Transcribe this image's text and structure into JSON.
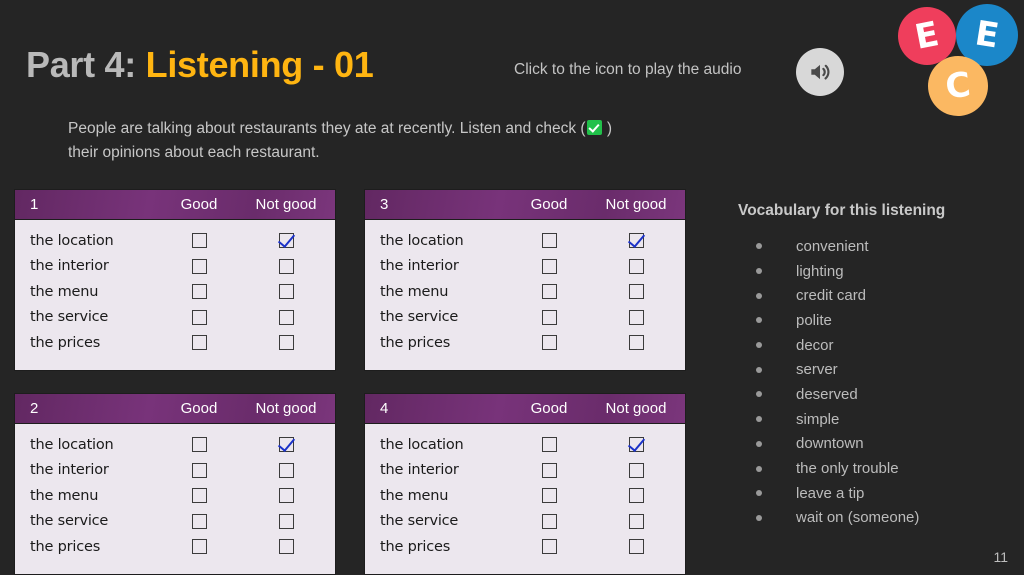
{
  "slide": {
    "background_color": "#252525",
    "page_number": "11"
  },
  "header": {
    "title_part": "Part 4:",
    "title_highlight": "Listening - 01",
    "title_part_color": "#b9b9b9",
    "title_highlight_color": "#ffb511",
    "audio_hint": "Click to the icon to play the audio",
    "audio_icon": "speaker-volume-icon"
  },
  "logo": {
    "circles": [
      {
        "letter": "E",
        "color": "#ef3e5c"
      },
      {
        "letter": "E",
        "color": "#1b87c9"
      },
      {
        "letter": "C",
        "color": "#fbb košice"
      }
    ]
  },
  "logo_fixed": {
    "e1_letter": "E",
    "e1_color": "#ef3e5c",
    "e2_letter": "E",
    "e2_color": "#1b87c9",
    "c_letter": "C",
    "c_color": "#fbb862"
  },
  "instruction": {
    "line1_before": "People are talking about restaurants they ate at recently. Listen and check (",
    "check_icon": "green-check-emoji",
    "line1_after": " )",
    "line2": "their opinions about each restaurant."
  },
  "tables": {
    "columns": {
      "good": "Good",
      "not_good": "Not good"
    },
    "row_labels": [
      "the location",
      "the interior",
      "the menu",
      "the service",
      "the prices"
    ],
    "items": [
      {
        "number": "1",
        "rows": [
          {
            "label": "the location",
            "good": false,
            "not_good": true
          },
          {
            "label": "the interior",
            "good": false,
            "not_good": false
          },
          {
            "label": "the menu",
            "good": false,
            "not_good": false
          },
          {
            "label": "the service",
            "good": false,
            "not_good": false
          },
          {
            "label": "the prices",
            "good": false,
            "not_good": false
          }
        ]
      },
      {
        "number": "2",
        "rows": [
          {
            "label": "the location",
            "good": false,
            "not_good": true
          },
          {
            "label": "the interior",
            "good": false,
            "not_good": false
          },
          {
            "label": "the menu",
            "good": false,
            "not_good": false
          },
          {
            "label": "the service",
            "good": false,
            "not_good": false
          },
          {
            "label": "the prices",
            "good": false,
            "not_good": false
          }
        ]
      },
      {
        "number": "3",
        "rows": [
          {
            "label": "the location",
            "good": false,
            "not_good": true
          },
          {
            "label": "the interior",
            "good": false,
            "not_good": false
          },
          {
            "label": "the menu",
            "good": false,
            "not_good": false
          },
          {
            "label": "the service",
            "good": false,
            "not_good": false
          },
          {
            "label": "the prices",
            "good": false,
            "not_good": false
          }
        ]
      },
      {
        "number": "4",
        "rows": [
          {
            "label": "the location",
            "good": false,
            "not_good": true
          },
          {
            "label": "the interior",
            "good": false,
            "not_good": false
          },
          {
            "label": "the menu",
            "good": false,
            "not_good": false
          },
          {
            "label": "the service",
            "good": false,
            "not_good": false
          },
          {
            "label": "the prices",
            "good": false,
            "not_good": false
          }
        ]
      }
    ],
    "header_color": "#6d2c6e",
    "body_color": "#ece7ee",
    "check_color": "#1b32c8"
  },
  "vocabulary": {
    "title": "Vocabulary for this listening",
    "items": [
      "convenient",
      "lighting",
      "credit card",
      "polite",
      "decor",
      "server",
      "deserved",
      "simple",
      "downtown",
      "the only trouble",
      "leave a tip",
      "wait on (someone)"
    ]
  }
}
